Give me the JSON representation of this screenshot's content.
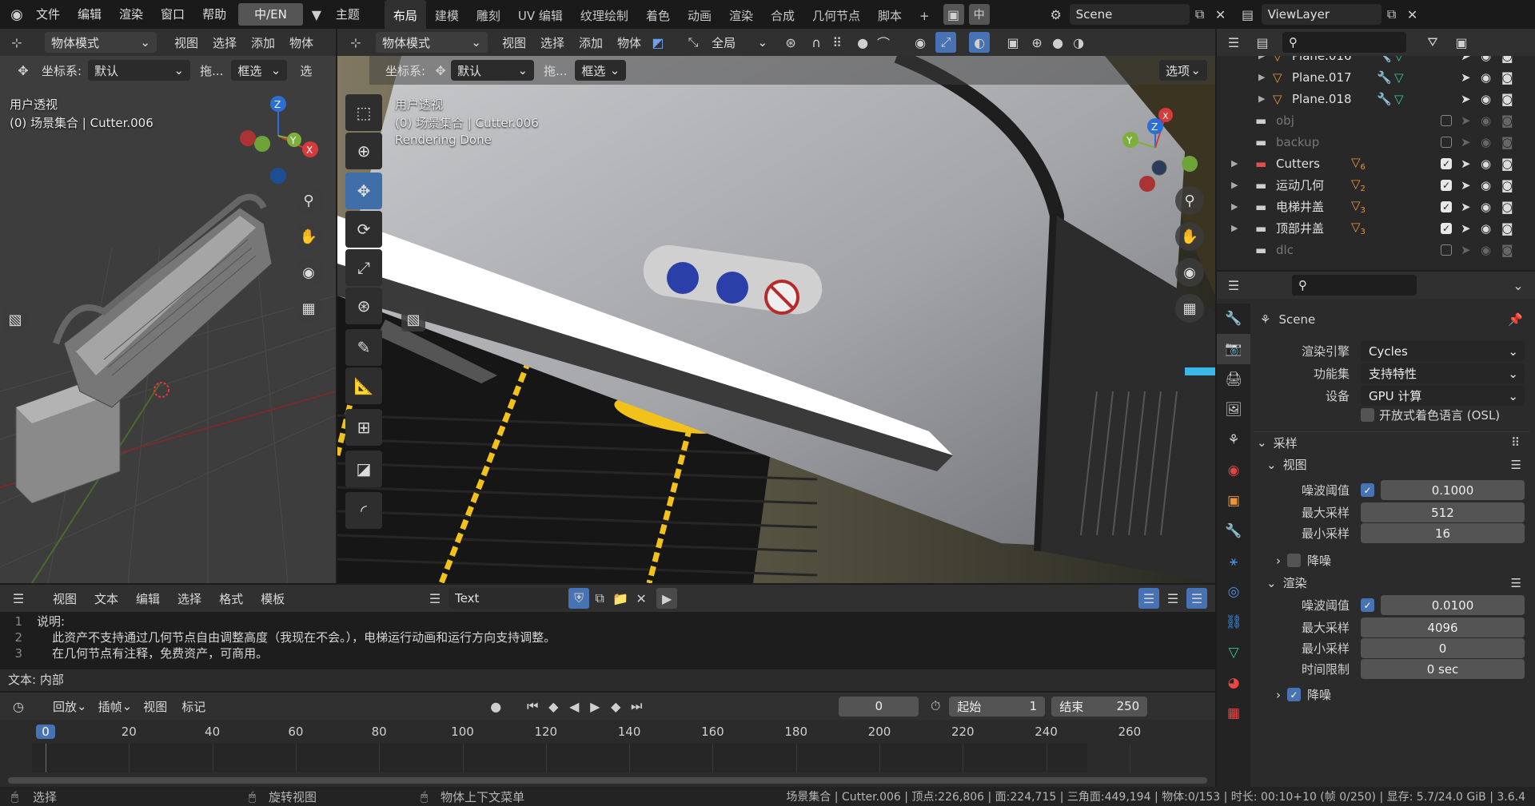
{
  "topbar": {
    "menus": [
      "文件",
      "编辑",
      "渲染",
      "窗口",
      "帮助"
    ],
    "lang": "中/EN",
    "theme": "主题",
    "tabs": [
      "布局",
      "建模",
      "雕刻",
      "UV 编辑",
      "纹理绘制",
      "着色",
      "动画",
      "渲染",
      "合成",
      "几何节点",
      "脚本"
    ],
    "active_tab": "布局",
    "add_tab": "+",
    "zh": "中",
    "scene": "Scene",
    "viewlayer": "ViewLayer"
  },
  "left_view": {
    "mode": "物体模式",
    "menus": [
      "视图",
      "选择",
      "添加",
      "物体"
    ],
    "coord_label": "坐标系:",
    "coord_value": "默认",
    "drag_label": "拖...",
    "select_mode": "框选",
    "overflow": "选",
    "title": "用户透视",
    "subtitle": "(0) 场景集合 | Cutter.006"
  },
  "main_view": {
    "mode": "物体模式",
    "menus": [
      "视图",
      "选择",
      "添加",
      "物体"
    ],
    "transform": "全局",
    "coord_label": "坐标系:",
    "coord_value": "默认",
    "drag_label": "拖...",
    "select_mode": "框选",
    "options": "选项",
    "title": "用户透视",
    "subtitle": "(0) 场景集合 | Cutter.006",
    "status": "Rendering Done"
  },
  "outliner": {
    "rows": [
      {
        "name": "Plane.016",
        "type": "mesh"
      },
      {
        "name": "Plane.017",
        "type": "mesh"
      },
      {
        "name": "Plane.018",
        "type": "mesh"
      },
      {
        "name": "obj",
        "type": "coll",
        "off": true
      },
      {
        "name": "backup",
        "type": "coll",
        "off": true
      },
      {
        "name": "Cutters",
        "type": "coll",
        "count": "6",
        "red": true
      },
      {
        "name": "运动几何",
        "type": "coll",
        "count": "2"
      },
      {
        "name": "电梯井盖",
        "type": "coll",
        "count": "3"
      },
      {
        "name": "顶部井盖",
        "type": "coll",
        "count": "3"
      },
      {
        "name": "dlc",
        "type": "coll",
        "off": true
      }
    ]
  },
  "properties": {
    "scene": "Scene",
    "engine_label": "渲染引擎",
    "engine": "Cycles",
    "featureset_label": "功能集",
    "featureset": "支持特性",
    "device_label": "设备",
    "device": "GPU 计算",
    "osl": "开放式着色语言 (OSL)",
    "sampling": "采样",
    "viewport": "视图",
    "v_noise_label": "噪波阈值",
    "v_noise": "0.1000",
    "v_max_label": "最大采样",
    "v_max": "512",
    "v_min_label": "最小采样",
    "v_min": "16",
    "v_denoise": "降噪",
    "render": "渲染",
    "r_noise_label": "噪波阈值",
    "r_noise": "0.0100",
    "r_max_label": "最大采样",
    "r_max": "4096",
    "r_min_label": "最小采样",
    "r_min": "0",
    "r_time_label": "时间限制",
    "r_time": "0 sec",
    "r_denoise": "降噪"
  },
  "text_editor": {
    "menus": [
      "视图",
      "文本",
      "编辑",
      "选择",
      "格式",
      "模板"
    ],
    "name": "Text",
    "lines": [
      "说明:",
      "    此资产不支持通过几何节点自由调整高度（我现在不会。），电梯运行动画和运行方向支持调整。",
      "    在几何节点有注释，免费资产，可商用。"
    ],
    "footer": "文本: 内部"
  },
  "timeline": {
    "menus": [
      "回放",
      "插帧",
      "视图",
      "标记"
    ],
    "current": "0",
    "start_label": "起始",
    "start": "1",
    "end_label": "结束",
    "end": "250",
    "ticks": [
      "0",
      "20",
      "40",
      "60",
      "80",
      "100",
      "120",
      "140",
      "160",
      "180",
      "200",
      "220",
      "240",
      "260"
    ]
  },
  "statusbar": {
    "select": "选择",
    "rotate": "旋转视图",
    "context": "物体上下文菜单",
    "stats": "场景集合 | Cutter.006 | 顶点:226,806 | 面:224,715 | 三角面:449,194 | 物体:0/153 | 时长: 00:10+10 (帧 0/250) | 显存: 5.7/24.0 GiB | 3.6.4"
  },
  "colors": {
    "accent": "#4772b3",
    "active_tool": "#3f6ea8",
    "frame": "#4772b3",
    "yellow": "#f2c21b"
  }
}
